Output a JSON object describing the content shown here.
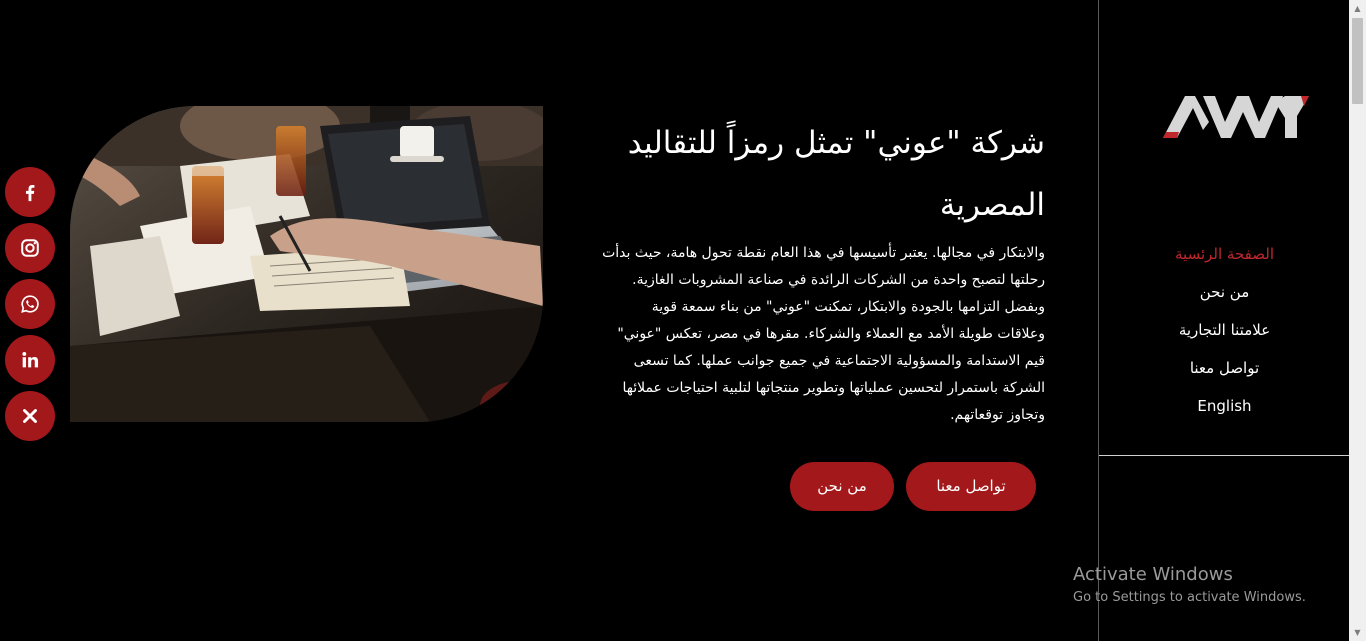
{
  "brand": {
    "logo_text": "AWNY",
    "accent_color": "#a3181b",
    "active_nav_color": "#c0272d"
  },
  "nav": {
    "items": [
      {
        "label": "الصفحة الرئسية",
        "active": true
      },
      {
        "label": "من نحن",
        "active": false
      },
      {
        "label": "علامتنا التجارية",
        "active": false
      },
      {
        "label": "تواصل معنا",
        "active": false
      },
      {
        "label": "English",
        "active": false
      }
    ]
  },
  "social": [
    {
      "name": "facebook",
      "icon": "facebook-icon"
    },
    {
      "name": "instagram",
      "icon": "instagram-icon"
    },
    {
      "name": "whatsapp",
      "icon": "whatsapp-icon"
    },
    {
      "name": "linkedin",
      "icon": "linkedin-icon"
    },
    {
      "name": "x",
      "icon": "x-icon"
    }
  ],
  "hero": {
    "title": "شركة \"عوني\" تمثل رمزاً للتقاليد المصرية",
    "description": "والابتكار في مجالها. يعتبر تأسيسها في هذا العام نقطة تحول هامة، حيث بدأت رحلتها لتصبح واحدة من الشركات الرائدة في صناعة المشروبات الغازية. وبفضل التزامها بالجودة والابتكار، تمكنت \"عوني\" من بناء سمعة قوية وعلاقات طويلة الأمد مع العملاء والشركاء. مقرها في مصر، تعكس \"عوني\" قيم الاستدامة والمسؤولية الاجتماعية في جميع جوانب عملها. كما تسعى الشركة باستمرار لتحسين عملياتها وتطوير منتجاتها لتلبية احتياجات عملائها وتجاوز توقعاتهم.",
    "primary_button": "تواصل معنا",
    "secondary_button": "من نحن",
    "image": "people-working-at-table-photo"
  },
  "watermark": {
    "line1": "Activate Windows",
    "line2": "Go to Settings to activate Windows."
  }
}
